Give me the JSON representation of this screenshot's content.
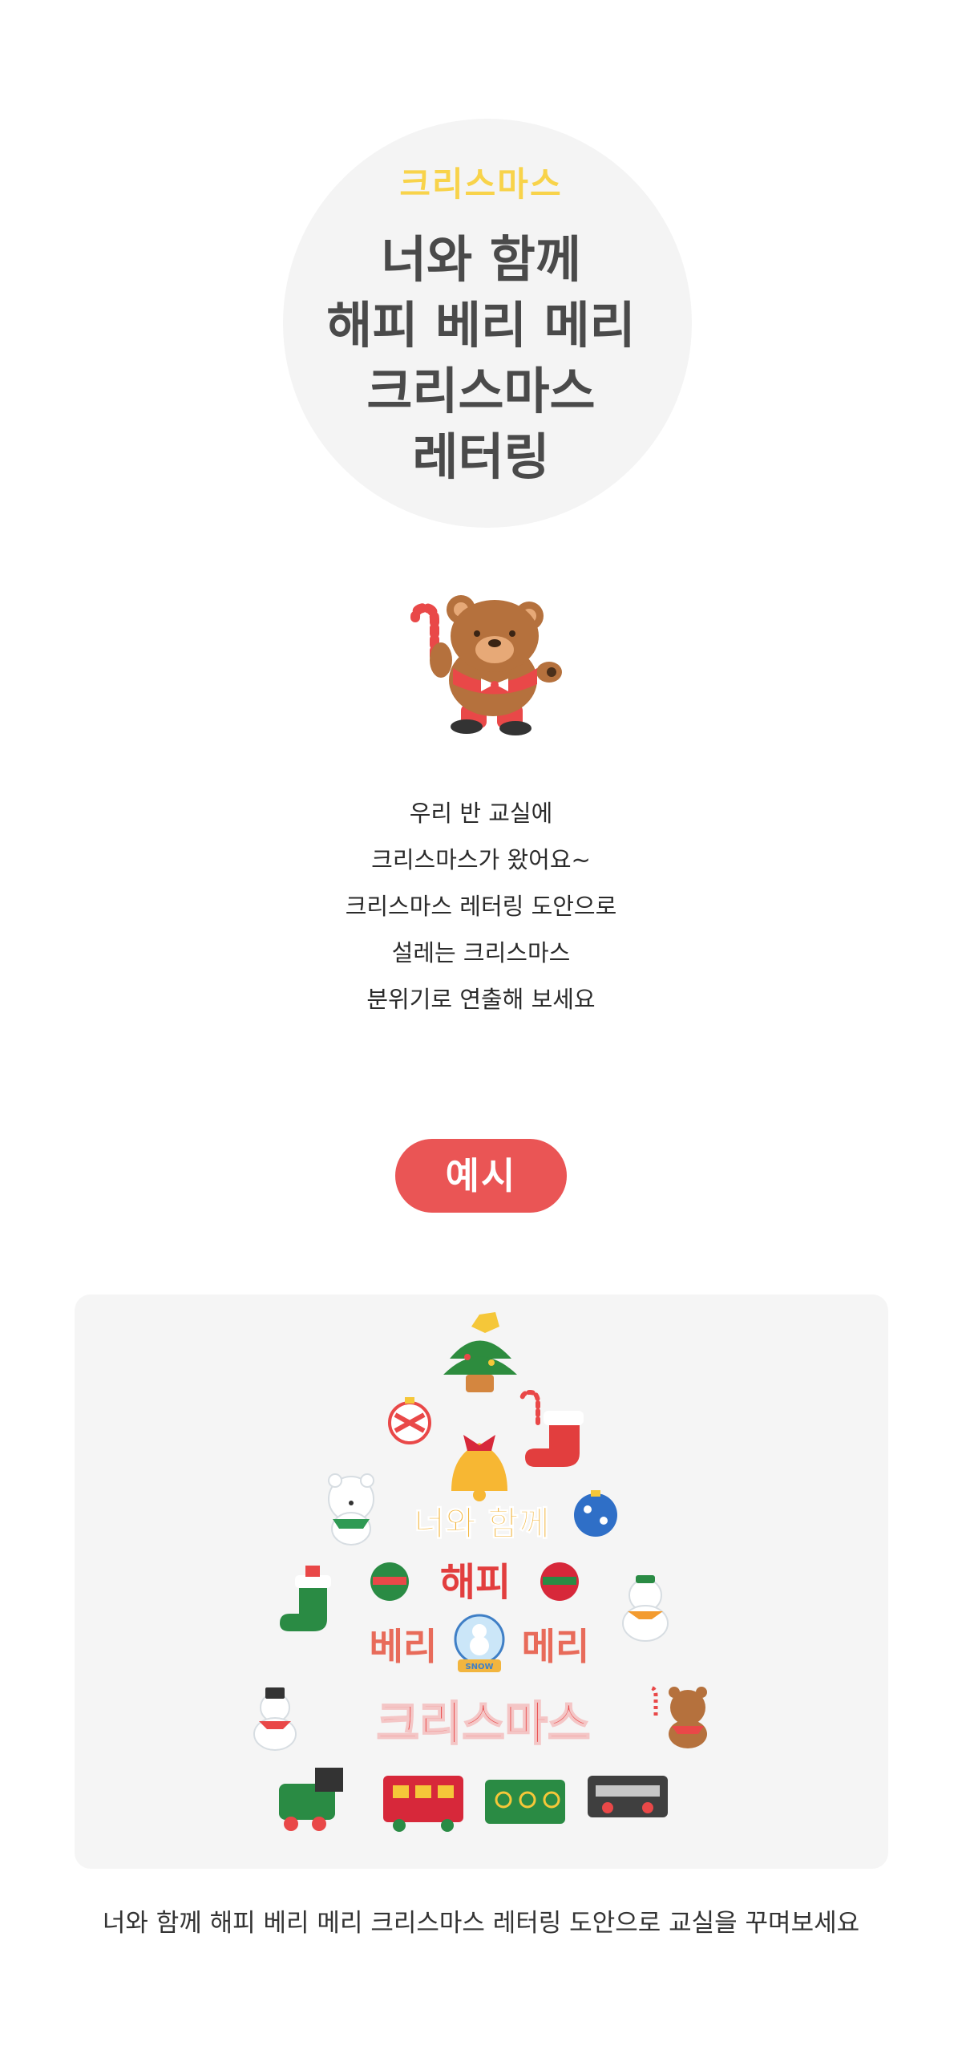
{
  "hero": {
    "subtitle": "크리스마스",
    "title_lines": [
      "너와 함께",
      "해피 베리 메리",
      "크리스마스",
      "레터링"
    ]
  },
  "description_lines": [
    "우리 반 교실에",
    "크리스마스가 왔어요~",
    "크리스마스 레터링 도안으로",
    "설레는 크리스마스",
    "분위기로 연출해 보세요"
  ],
  "example": {
    "label": "예시",
    "lettering": {
      "line1": "너와 함께",
      "line2": "해피",
      "line3_left": "베리",
      "line3_right": "메리",
      "line4": "크리스마스",
      "globe_text": "SNOW"
    }
  },
  "caption": "너와 함께 해피 베리 메리 크리스마스 레터링 도안으로 교실을 꾸며보세요",
  "colors": {
    "accent_red": "#ea5555",
    "subtitle_yellow": "#f8d34a",
    "title_gray": "#4a4a4a",
    "circle_bg": "#f4f4f4",
    "card_bg": "#f5f5f5"
  }
}
